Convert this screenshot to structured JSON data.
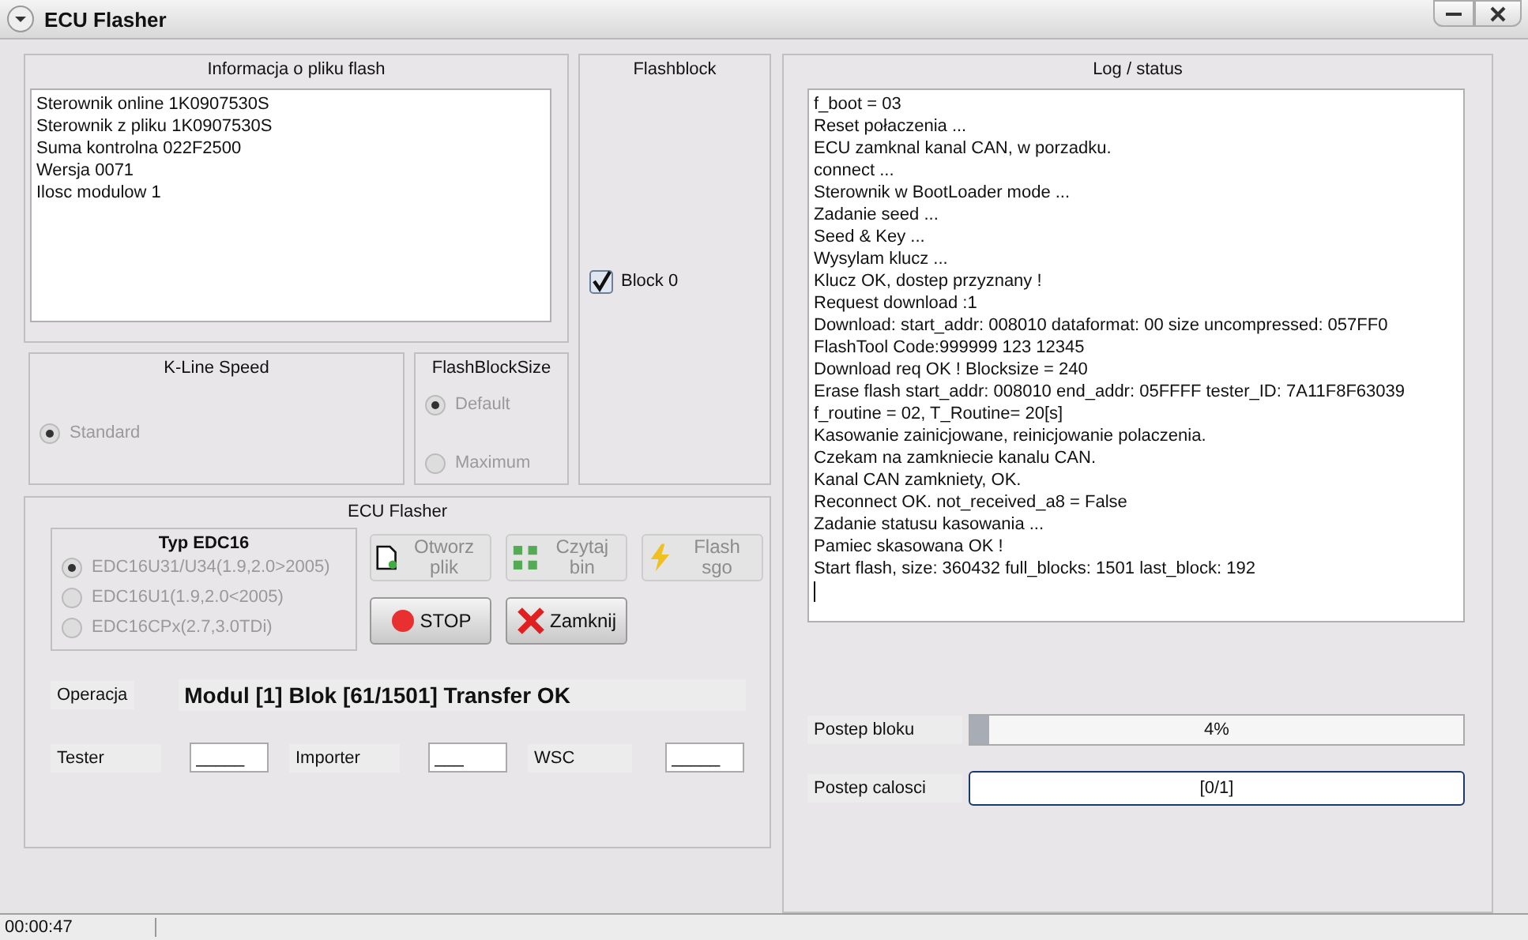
{
  "window": {
    "title": "ECU Flasher"
  },
  "file_info": {
    "title": "Informacja o pliku flash",
    "lines": [
      "Sterownik online 1K0907530S",
      "Sterownik z pliku 1K0907530S",
      "Suma kontrolna 022F2500",
      "Wersja 0071",
      "Ilosc modulow 1"
    ]
  },
  "flashblock": {
    "title": "Flashblock",
    "blocks": [
      {
        "label": "Block 0",
        "checked": true
      }
    ]
  },
  "kline_speed": {
    "title": "K-Line Speed",
    "options": [
      {
        "label": "Standard",
        "selected": true,
        "disabled": true
      }
    ]
  },
  "flash_block_size": {
    "title": "FlashBlockSize",
    "options": [
      {
        "label": "Default",
        "selected": true,
        "disabled": true
      },
      {
        "label": "Maximum",
        "selected": false,
        "disabled": true
      }
    ]
  },
  "ecu_flasher": {
    "title": "ECU Flasher",
    "edc_type": {
      "title": "Typ EDC16",
      "options": [
        {
          "label": "EDC16U31/U34(1.9,2.0>2005)",
          "selected": true,
          "disabled": true
        },
        {
          "label": "EDC16U1(1.9,2.0<2005)",
          "selected": false,
          "disabled": true
        },
        {
          "label": "EDC16CPx(2.7,3.0TDi)",
          "selected": false,
          "disabled": true
        }
      ]
    },
    "buttons": [
      {
        "label": "Otworz plik",
        "kind": "open",
        "disabled": true
      },
      {
        "label": "Czytaj bin",
        "kind": "read",
        "disabled": true
      },
      {
        "label": "Flash sgo",
        "kind": "flash",
        "disabled": true
      },
      {
        "label": "STOP",
        "kind": "stop",
        "disabled": false
      },
      {
        "label": "Zamknij",
        "kind": "close",
        "disabled": false
      }
    ],
    "operation_label": "Operacja",
    "operation": "Modul [1] Blok [61/1501] Transfer OK",
    "fields": [
      {
        "label": "Tester",
        "value": "_____"
      },
      {
        "label": "Importer",
        "value": "___"
      },
      {
        "label": "WSC",
        "value": "_____"
      }
    ]
  },
  "log": {
    "title": "Log / status",
    "lines": [
      "f_boot = 03",
      "Reset połaczenia  ...",
      "ECU zamknal kanal CAN, w porzadku.",
      "connect ...",
      "Sterownik w BootLoader mode ...",
      "Zadanie seed ...",
      "Seed & Key ...",
      "Wysylam klucz ...",
      "Klucz OK, dostep przyznany !",
      "Request download :1",
      "Download: start_addr: 008010 dataformat: 00 size uncompressed: 057FF0",
      "FlashTool Code:999999 123 12345",
      "Download req OK ! Blocksize = 240",
      "Erase flash start_addr: 008010 end_addr: 05FFFF tester_ID: 7A11F8F63039",
      "f_routine = 02, T_Routine= 20[s]",
      "Kasowanie zainicjowane, reinicjowanie polaczenia.",
      "Czekam na zamkniecie kanalu CAN.",
      "Kanal CAN zamkniety, OK.",
      "Reconnect OK. not_received_a8 = False",
      "Zadanie statusu kasowania ...",
      "Pamiec skasowana OK !",
      "Start flash, size: 360432 full_blocks: 1501 last_block: 192"
    ]
  },
  "progress": [
    {
      "label": "Postep bloku",
      "level": 0.04,
      "text": "4%",
      "focused": false
    },
    {
      "label": "Postep  calosci",
      "level": 0,
      "text": "[0/1]",
      "focused": true
    }
  ],
  "status_bar": {
    "time": "00:00:47"
  }
}
